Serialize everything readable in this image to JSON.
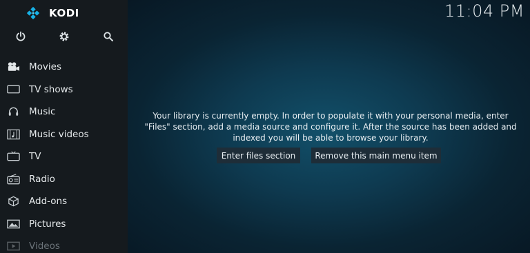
{
  "app": {
    "name": "KODI"
  },
  "clock": {
    "time": "11:04 PM"
  },
  "top_icons": [
    "power-icon",
    "gear-icon",
    "search-icon"
  ],
  "sidebar": {
    "items": [
      {
        "label": "Movies",
        "icon": "movie-camera-icon"
      },
      {
        "label": "TV shows",
        "icon": "tv-shows-icon"
      },
      {
        "label": "Music",
        "icon": "headphones-icon"
      },
      {
        "label": "Music videos",
        "icon": "music-videos-icon"
      },
      {
        "label": "TV",
        "icon": "tv-icon"
      },
      {
        "label": "Radio",
        "icon": "radio-icon"
      },
      {
        "label": "Add-ons",
        "icon": "addons-box-icon"
      },
      {
        "label": "Pictures",
        "icon": "pictures-icon"
      },
      {
        "label": "Videos",
        "icon": "videos-icon"
      }
    ]
  },
  "main": {
    "message_lines": [
      "Your library is currently empty. In order to populate it with your personal media, enter",
      "\"Files\" section, add a media source and configure it. After the source has been added and",
      "indexed you will be able to browse your library."
    ],
    "buttons": {
      "enter_files": "Enter files section",
      "remove_item": "Remove this main menu item"
    }
  },
  "colors": {
    "sidebar_bg": "#151a1e",
    "accent": "#17b2e7",
    "button_bg": "#1e2d38"
  }
}
